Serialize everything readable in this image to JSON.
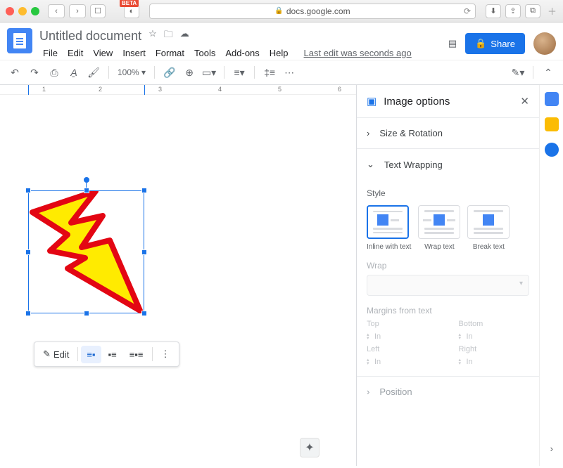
{
  "browser": {
    "url": "docs.google.com",
    "beta_badge": "BETA"
  },
  "doc": {
    "title": "Untitled document",
    "menus": [
      "File",
      "Edit",
      "View",
      "Insert",
      "Format",
      "Tools",
      "Add-ons",
      "Help"
    ],
    "last_edit": "Last edit was seconds ago",
    "share": "Share",
    "zoom": "100%"
  },
  "ruler": [
    "1",
    "2",
    "3",
    "4",
    "5",
    "6"
  ],
  "image_toolbar": {
    "edit": "Edit"
  },
  "panel": {
    "title": "Image options",
    "size_rotation": "Size & Rotation",
    "text_wrapping": "Text Wrapping",
    "style_label": "Style",
    "styles": [
      {
        "label": "Inline with text"
      },
      {
        "label": "Wrap text"
      },
      {
        "label": "Break text"
      }
    ],
    "wrap_label": "Wrap",
    "margins_label": "Margins from text",
    "margin_fields": {
      "top": "Top",
      "bottom": "Bottom",
      "left": "Left",
      "right": "Right",
      "unit": "In"
    },
    "position": "Position"
  }
}
